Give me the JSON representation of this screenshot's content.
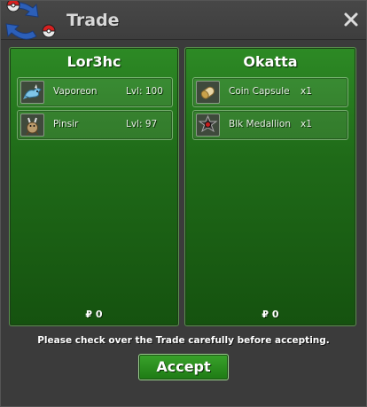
{
  "window": {
    "title": "Trade",
    "logo_icon": "swap-arrows-icon",
    "close_icon": "close-icon"
  },
  "trade": {
    "left": {
      "name": "Lor3hc",
      "items": [
        {
          "icon": "vaporeon-icon",
          "name": "Vaporeon",
          "extra": "Lvl: 100"
        },
        {
          "icon": "pinsir-icon",
          "name": "Pinsir",
          "extra": "Lvl: 97"
        }
      ],
      "money": "₽ 0"
    },
    "right": {
      "name": "Okatta",
      "items": [
        {
          "icon": "coin-capsule-icon",
          "name": "Coin Capsule",
          "extra": "x1"
        },
        {
          "icon": "blk-medallion-icon",
          "name": "Blk Medallion",
          "extra": "x1"
        }
      ],
      "money": "₽ 0"
    }
  },
  "footer": {
    "notice": "Please check over the Trade carefully before accepting.",
    "accept_label": "Accept"
  },
  "colors": {
    "panel_green": "#1f6a18",
    "accept_green": "#2a8f1f",
    "window_bg": "#3b3b3b"
  }
}
